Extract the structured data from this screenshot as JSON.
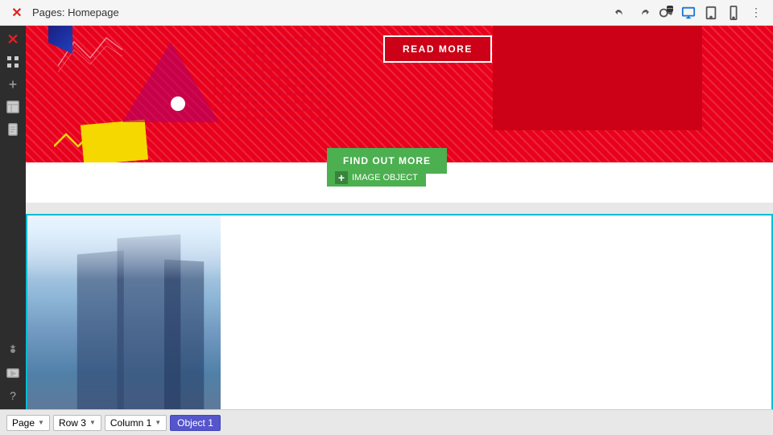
{
  "topbar": {
    "title": "Pages: Homepage",
    "undo_label": "↺",
    "redo_label": "↻"
  },
  "sidebar": {
    "icons": [
      "×",
      "⊞",
      "+",
      "⊡",
      "⊞",
      "⚙",
      "▶",
      "?"
    ]
  },
  "canvas": {
    "read_more_label": "READ MORE",
    "find_out_more_label": "FIND OUT MORE",
    "image_object_label": "IMAGE OBJECT"
  },
  "bottombar": {
    "page_label": "Page",
    "row_label": "Row 3",
    "column_label": "Column 1",
    "object_label": "Object 1"
  }
}
